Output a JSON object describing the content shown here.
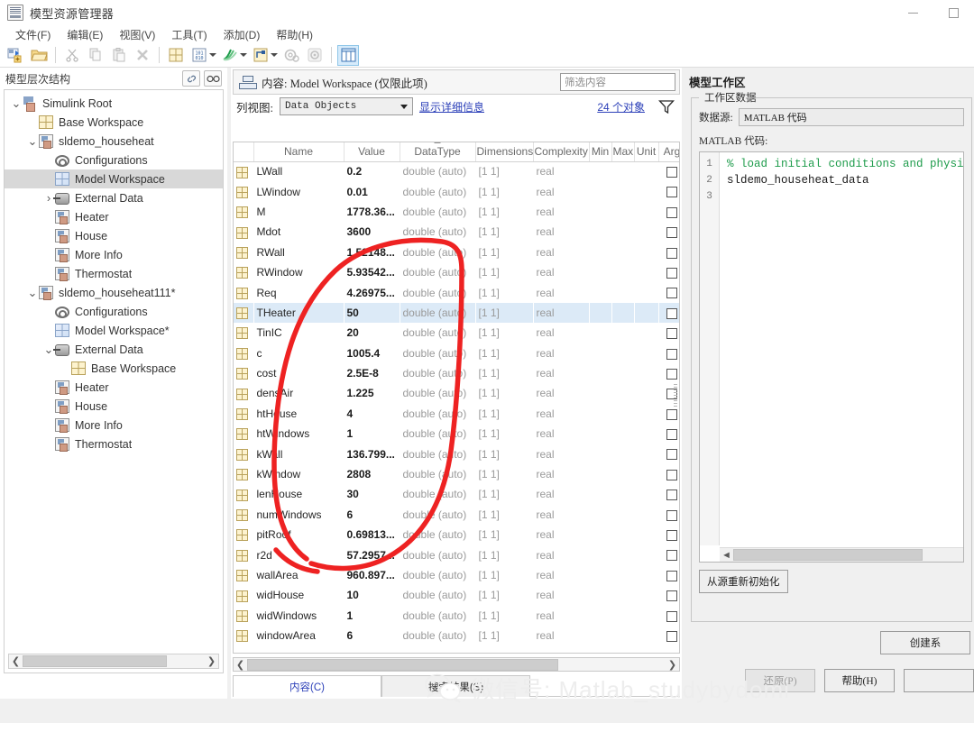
{
  "window": {
    "title": "模型资源管理器",
    "icon": "app-window-icon",
    "minimize": "−",
    "maximize": "□"
  },
  "menubar": {
    "items": [
      {
        "label": "文件(F)",
        "name": "menu-file"
      },
      {
        "label": "编辑(E)",
        "name": "menu-edit"
      },
      {
        "label": "视图(V)",
        "name": "menu-view"
      },
      {
        "label": "工具(T)",
        "name": "menu-tools"
      },
      {
        "label": "添加(D)",
        "name": "menu-add"
      },
      {
        "label": "帮助(H)",
        "name": "menu-help"
      }
    ]
  },
  "toolbar": {
    "buttons": [
      {
        "icon": "new-model-icon",
        "enabled": true
      },
      {
        "icon": "open-folder-icon",
        "enabled": true
      },
      {
        "icon": "cut-icon",
        "enabled": false
      },
      {
        "icon": "copy-icon",
        "enabled": false
      },
      {
        "icon": "paste-icon",
        "enabled": false
      },
      {
        "icon": "delete-icon",
        "enabled": false
      },
      {
        "icon": "add-parameter-icon",
        "enabled": true
      },
      {
        "icon": "add-data-icon",
        "enabled": true
      },
      {
        "icon": "add-signal-icon",
        "enabled": true
      },
      {
        "icon": "add-bus-icon",
        "enabled": true
      },
      {
        "icon": "configuration-icon",
        "enabled": false
      },
      {
        "icon": "settings-gear-icon",
        "enabled": false
      },
      {
        "icon": "column-view-icon",
        "enabled": true,
        "active": true
      }
    ]
  },
  "left_panel": {
    "header": "模型层次结构",
    "header_icons": [
      "link-icon",
      "glasses-icon"
    ],
    "tree": [
      {
        "label": "Simulink Root",
        "indent": 0,
        "twisty": "down",
        "icon": "simulink-root-icon",
        "selected": false
      },
      {
        "label": "Base Workspace",
        "indent": 1,
        "twisty": "",
        "icon": "workspace-grid-icon",
        "selected": false
      },
      {
        "label": "sldemo_househeat",
        "indent": 1,
        "twisty": "down",
        "icon": "model-icon",
        "selected": false
      },
      {
        "label": "Configurations",
        "indent": 2,
        "twisty": "",
        "icon": "configurations-icon",
        "selected": false
      },
      {
        "label": "Model Workspace",
        "indent": 2,
        "twisty": "",
        "icon": "model-workspace-icon",
        "selected": true
      },
      {
        "label": "External Data",
        "indent": 2,
        "twisty": "right",
        "icon": "external-data-icon",
        "selected": false
      },
      {
        "label": "Heater",
        "indent": 2,
        "twisty": "",
        "icon": "subsystem-icon",
        "selected": false
      },
      {
        "label": "House",
        "indent": 2,
        "twisty": "",
        "icon": "subsystem-icon",
        "selected": false
      },
      {
        "label": "More Info",
        "indent": 2,
        "twisty": "",
        "icon": "subsystem-icon",
        "selected": false
      },
      {
        "label": "Thermostat",
        "indent": 2,
        "twisty": "",
        "icon": "subsystem-icon",
        "selected": false
      },
      {
        "label": "sldemo_househeat111*",
        "indent": 1,
        "twisty": "down",
        "icon": "model-icon",
        "selected": false
      },
      {
        "label": "Configurations",
        "indent": 2,
        "twisty": "",
        "icon": "configurations-icon",
        "selected": false
      },
      {
        "label": "Model Workspace*",
        "indent": 2,
        "twisty": "",
        "icon": "model-workspace-icon",
        "selected": false
      },
      {
        "label": "External Data",
        "indent": 2,
        "twisty": "down",
        "icon": "external-data-icon",
        "selected": false
      },
      {
        "label": "Base Workspace",
        "indent": 3,
        "twisty": "",
        "icon": "workspace-grid-icon",
        "selected": false
      },
      {
        "label": "Heater",
        "indent": 2,
        "twisty": "",
        "icon": "subsystem-icon",
        "selected": false
      },
      {
        "label": "House",
        "indent": 2,
        "twisty": "",
        "icon": "subsystem-icon",
        "selected": false
      },
      {
        "label": "More Info",
        "indent": 2,
        "twisty": "",
        "icon": "subsystem-icon",
        "selected": false
      },
      {
        "label": "Thermostat",
        "indent": 2,
        "twisty": "",
        "icon": "subsystem-icon",
        "selected": false
      }
    ]
  },
  "mid_panel": {
    "contents_label": "内容: Model Workspace (仅限此项)",
    "filter_placeholder": "筛选内容",
    "filter_value": "",
    "column_view_label": "列视图:",
    "column_view_value": "Data Objects",
    "show_details_link": "显示详细信息",
    "object_count": "24 个对象",
    "filter_icon": "funnel-icon",
    "columns": [
      "Name",
      "Value",
      "DataType",
      "Dimensions",
      "Complexity",
      "Min",
      "Max",
      "Unit",
      "Arg"
    ],
    "sorted_column": "DataType",
    "rows": [
      {
        "name": "LWall",
        "value": "0.2",
        "datatype": "double (auto)",
        "dimensions": "[1 1]",
        "complexity": "real",
        "min": "",
        "max": "",
        "unit": "",
        "arg": false,
        "selected": false
      },
      {
        "name": "LWindow",
        "value": "0.01",
        "datatype": "double (auto)",
        "dimensions": "[1 1]",
        "complexity": "real",
        "min": "",
        "max": "",
        "unit": "",
        "arg": false,
        "selected": false
      },
      {
        "name": "M",
        "value": "1778.36...",
        "datatype": "double (auto)",
        "dimensions": "[1 1]",
        "complexity": "real",
        "min": "",
        "max": "",
        "unit": "",
        "arg": false,
        "selected": false
      },
      {
        "name": "Mdot",
        "value": "3600",
        "datatype": "double (auto)",
        "dimensions": "[1 1]",
        "complexity": "real",
        "min": "",
        "max": "",
        "unit": "",
        "arg": false,
        "selected": false
      },
      {
        "name": "RWall",
        "value": "1.52148...",
        "datatype": "double (auto)",
        "dimensions": "[1 1]",
        "complexity": "real",
        "min": "",
        "max": "",
        "unit": "",
        "arg": false,
        "selected": false
      },
      {
        "name": "RWindow",
        "value": "5.93542...",
        "datatype": "double (auto)",
        "dimensions": "[1 1]",
        "complexity": "real",
        "min": "",
        "max": "",
        "unit": "",
        "arg": false,
        "selected": false
      },
      {
        "name": "Req",
        "value": "4.26975...",
        "datatype": "double (auto)",
        "dimensions": "[1 1]",
        "complexity": "real",
        "min": "",
        "max": "",
        "unit": "",
        "arg": false,
        "selected": false
      },
      {
        "name": "THeater",
        "value": "50",
        "datatype": "double (auto)",
        "dimensions": "[1 1]",
        "complexity": "real",
        "min": "",
        "max": "",
        "unit": "",
        "arg": false,
        "selected": true
      },
      {
        "name": "TinIC",
        "value": "20",
        "datatype": "double (auto)",
        "dimensions": "[1 1]",
        "complexity": "real",
        "min": "",
        "max": "",
        "unit": "",
        "arg": false,
        "selected": false
      },
      {
        "name": "c",
        "value": "1005.4",
        "datatype": "double (auto)",
        "dimensions": "[1 1]",
        "complexity": "real",
        "min": "",
        "max": "",
        "unit": "",
        "arg": false,
        "selected": false
      },
      {
        "name": "cost",
        "value": "2.5E-8",
        "datatype": "double (auto)",
        "dimensions": "[1 1]",
        "complexity": "real",
        "min": "",
        "max": "",
        "unit": "",
        "arg": false,
        "selected": false
      },
      {
        "name": "densAir",
        "value": "1.225",
        "datatype": "double (auto)",
        "dimensions": "[1 1]",
        "complexity": "real",
        "min": "",
        "max": "",
        "unit": "",
        "arg": false,
        "selected": false
      },
      {
        "name": "htHouse",
        "value": "4",
        "datatype": "double (auto)",
        "dimensions": "[1 1]",
        "complexity": "real",
        "min": "",
        "max": "",
        "unit": "",
        "arg": false,
        "selected": false
      },
      {
        "name": "htWindows",
        "value": "1",
        "datatype": "double (auto)",
        "dimensions": "[1 1]",
        "complexity": "real",
        "min": "",
        "max": "",
        "unit": "",
        "arg": false,
        "selected": false
      },
      {
        "name": "kWall",
        "value": "136.799...",
        "datatype": "double (auto)",
        "dimensions": "[1 1]",
        "complexity": "real",
        "min": "",
        "max": "",
        "unit": "",
        "arg": false,
        "selected": false
      },
      {
        "name": "kWindow",
        "value": "2808",
        "datatype": "double (auto)",
        "dimensions": "[1 1]",
        "complexity": "real",
        "min": "",
        "max": "",
        "unit": "",
        "arg": false,
        "selected": false
      },
      {
        "name": "lenHouse",
        "value": "30",
        "datatype": "double (auto)",
        "dimensions": "[1 1]",
        "complexity": "real",
        "min": "",
        "max": "",
        "unit": "",
        "arg": false,
        "selected": false
      },
      {
        "name": "numWindows",
        "value": "6",
        "datatype": "double (auto)",
        "dimensions": "[1 1]",
        "complexity": "real",
        "min": "",
        "max": "",
        "unit": "",
        "arg": false,
        "selected": false
      },
      {
        "name": "pitRoof",
        "value": "0.69813...",
        "datatype": "double (auto)",
        "dimensions": "[1 1]",
        "complexity": "real",
        "min": "",
        "max": "",
        "unit": "",
        "arg": false,
        "selected": false
      },
      {
        "name": "r2d",
        "value": "57.2957...",
        "datatype": "double (auto)",
        "dimensions": "[1 1]",
        "complexity": "real",
        "min": "",
        "max": "",
        "unit": "",
        "arg": false,
        "selected": false
      },
      {
        "name": "wallArea",
        "value": "960.897...",
        "datatype": "double (auto)",
        "dimensions": "[1 1]",
        "complexity": "real",
        "min": "",
        "max": "",
        "unit": "",
        "arg": false,
        "selected": false
      },
      {
        "name": "widHouse",
        "value": "10",
        "datatype": "double (auto)",
        "dimensions": "[1 1]",
        "complexity": "real",
        "min": "",
        "max": "",
        "unit": "",
        "arg": false,
        "selected": false
      },
      {
        "name": "widWindows",
        "value": "1",
        "datatype": "double (auto)",
        "dimensions": "[1 1]",
        "complexity": "real",
        "min": "",
        "max": "",
        "unit": "",
        "arg": false,
        "selected": false
      },
      {
        "name": "windowArea",
        "value": "6",
        "datatype": "double (auto)",
        "dimensions": "[1 1]",
        "complexity": "real",
        "min": "",
        "max": "",
        "unit": "",
        "arg": false,
        "selected": false
      }
    ],
    "tabs": [
      {
        "label": "内容(C)",
        "active": true
      },
      {
        "label": "搜索结果(S)",
        "active": false
      }
    ]
  },
  "right_panel": {
    "title": "模型工作区",
    "group_legend": "工作区数据",
    "data_source_label": "数据源:",
    "data_source_value": "MATLAB 代码",
    "code_label": "MATLAB 代码:",
    "code_lines": [
      {
        "no": "1",
        "text": "% load initial conditions and physi",
        "kind": "comment"
      },
      {
        "no": "2",
        "text": "",
        "kind": "code"
      },
      {
        "no": "3",
        "text": "sldemo_househeat_data",
        "kind": "code"
      }
    ],
    "reinit_button": "从源重新初始化",
    "create_button": "创建系",
    "footer_buttons": [
      {
        "label": "还原(P)",
        "enabled": false
      },
      {
        "label": "帮助(H)",
        "enabled": true
      },
      {
        "label": "",
        "enabled": true
      }
    ]
  },
  "watermark": {
    "text": "微信号: Matlab_studybydomi",
    "logo": "wechat-icon"
  },
  "annotation": {
    "color": "#ee2222",
    "description": "hand-drawn red loop circling the Name and Value columns"
  },
  "colors": {
    "accent_link": "#2b3fb8",
    "selection": "#dceaf7",
    "tree_selection": "#d8d8d8",
    "annotation_red": "#ee2222",
    "comment_green": "#1f9c4c"
  }
}
